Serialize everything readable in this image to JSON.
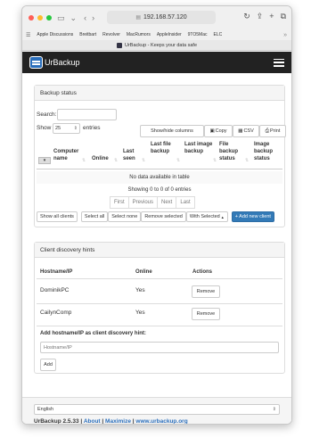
{
  "browser": {
    "address": "192.168.57.120",
    "bookmarks": [
      "Apple Discussions",
      "Breitbart",
      "Revolver",
      "MacRumors",
      "AppleInsider",
      "9TO5Mac",
      "ELC"
    ],
    "tab_title": "UrBackup - Keeps your data safe"
  },
  "navbar": {
    "brand": "UrBackup"
  },
  "backup_status": {
    "title": "Backup status",
    "search_label": "Search:",
    "show_label": "Show",
    "entries_value": "25",
    "entries_label": "entries",
    "buttons": {
      "show_hide": "Show/hide columns",
      "copy": "Copy",
      "csv": "CSV",
      "print": "Print"
    },
    "columns": {
      "computer_name": "Computer name",
      "online": "Online",
      "last_seen": "Last seen",
      "last_file_backup": "Last file backup",
      "last_image_backup": "Last image backup",
      "file_backup_status": "File backup status",
      "image_backup_status": "Image backup status"
    },
    "empty_message": "No data available in table",
    "info": "Showing 0 to 0 of 0 entries",
    "pagination": {
      "first": "First",
      "previous": "Previous",
      "next": "Next",
      "last": "Last"
    },
    "actions": {
      "show_all_clients": "Show all clients",
      "select_all": "Select all",
      "select_none": "Select none",
      "remove_selected": "Remove selected",
      "with_selected": "With Selected",
      "add_new_client": "+ Add new client"
    }
  },
  "discovery": {
    "title": "Client discovery hints",
    "columns": {
      "hostname": "Hostname/IP",
      "online": "Online",
      "actions": "Actions"
    },
    "rows": [
      {
        "hostname": "DominikPC",
        "online": "Yes",
        "action": "Remove"
      },
      {
        "hostname": "CailynComp",
        "online": "Yes",
        "action": "Remove"
      }
    ],
    "add_label": "Add hostname/IP as client discovery hint:",
    "input_placeholder": "Hostname/IP",
    "add_button": "Add"
  },
  "footer": {
    "language": "English",
    "version": "UrBackup 2.5.33",
    "separator": "|",
    "about": "About",
    "maximize": "Maximize",
    "website": "www.urbackup.org"
  },
  "colors": {
    "navbar": "#222222",
    "primary": "#337ab7",
    "link": "#2a6ebb"
  }
}
